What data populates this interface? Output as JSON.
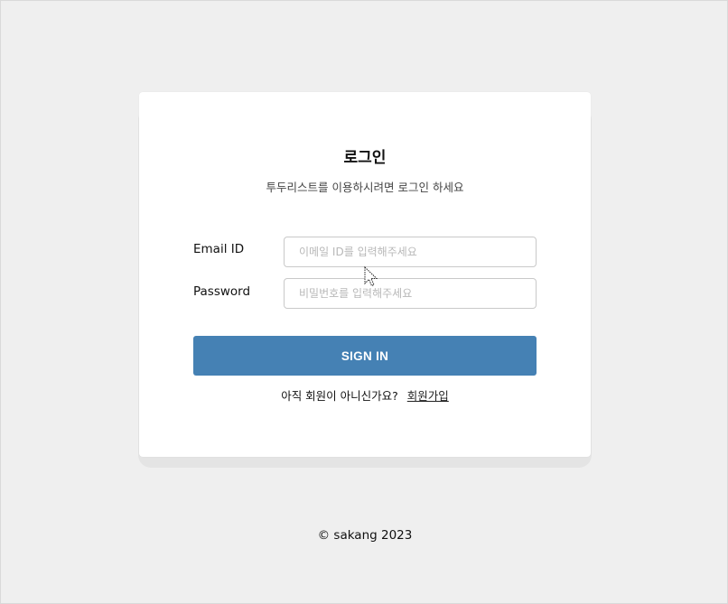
{
  "login": {
    "title": "로그인",
    "subtitle": "투두리스트를 이용하시려면 로그인 하세요",
    "email": {
      "label": "Email ID",
      "value": "",
      "placeholder": "이메일 ID를 입력해주세요"
    },
    "password": {
      "label": "Password",
      "value": "",
      "placeholder": "비밀번호를 입력해주세요"
    },
    "signin_label": "SIGN IN",
    "signup_prompt": "아직 회원이 아니신가요?",
    "signup_link": "회원가입"
  },
  "footer": {
    "text": "© sakang 2023"
  },
  "colors": {
    "background": "#efefef",
    "card": "#ffffff",
    "primary_button": "#4581b4"
  },
  "icons": {
    "cursor": "mouse-pointer-icon"
  }
}
